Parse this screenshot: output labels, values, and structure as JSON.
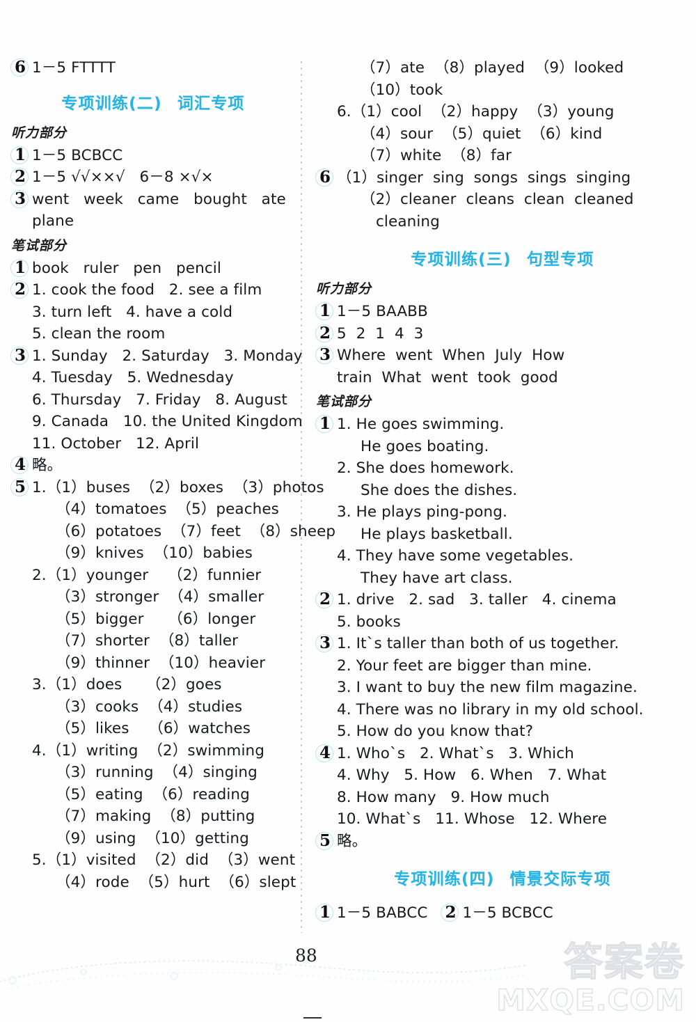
{
  "page": {
    "number": "88",
    "watermark_cn": "答案卷",
    "watermark_en": "MXQE.COM"
  },
  "labels": {
    "listening": "听力部分",
    "written": "笔试部分"
  },
  "sections": {
    "two": {
      "title": "专项训练(二)",
      "subtitle": "词汇专项"
    },
    "three": {
      "title": "专项训练(三)",
      "subtitle": "句型专项"
    },
    "four": {
      "title": "专项训练(四)",
      "subtitle": "情景交际专项"
    }
  },
  "left_column": {
    "carry_over": {
      "num": "6",
      "text": "1－5 FTTTT"
    },
    "listening": [
      {
        "num": "1",
        "lines": [
          "1－5 BCBCC"
        ]
      },
      {
        "num": "2",
        "lines": [
          "1－5 √√××√   6－8 ×√×"
        ]
      },
      {
        "num": "3",
        "lines": [
          "went   week   came   bought   ate",
          "plane"
        ]
      }
    ],
    "written": [
      {
        "num": "1",
        "lines": [
          "book   ruler   pen   pencil"
        ]
      },
      {
        "num": "2",
        "lines": [
          "1. cook the food   2. see a film",
          "3. turn left   4. have a cold",
          "5. clean the room"
        ]
      },
      {
        "num": "3",
        "lines": [
          "1. Sunday   2. Saturday   3. Monday",
          "4. Tuesday   5. Wednesday",
          "6. Thursday   7. Friday   8. August",
          "9. Canada   10. the United Kingdom",
          "11. October   12. April"
        ]
      },
      {
        "num": "4",
        "lines": [
          "略。"
        ]
      },
      {
        "num": "5",
        "lines": [
          "1.（1）buses  （2）boxes  （3）photos",
          "（4）tomatoes  （5）peaches",
          "（6）potatoes  （7）feet  （8）sheep",
          "（9）knives  （10）babies",
          "2.（1）younger    （2）funnier",
          "（3）stronger  （4）smaller",
          "（5）bigger     （6）longer",
          "（7）shorter  （8）taller",
          "（9）thinner  （10）heavier",
          "3.（1）does     （2）goes",
          "（3）cooks  （4）studies",
          "（5）likes    （6）watches",
          "4.（1）writing  （2）swimming",
          "（3）running  （4）singing",
          "（5）eating  （6）reading",
          "（7）making  （8）putting",
          "（9）using  （10）getting",
          "5.（1）visited  （2）did  （3）went",
          "（4）rode  （5）hurt  （6）slept"
        ]
      }
    ]
  },
  "right_column": {
    "continued_5": [
      "（7）ate  （8）played  （9）looked",
      "（10）took",
      "6.（1）cool  （2）happy  （3）young",
      "（4）sour  （5）quiet  （6）kind",
      "（7）white  （8）far"
    ],
    "q6": {
      "num": "6",
      "lines": [
        "（1）singer  sing  songs  sings  singing",
        "（2）cleaner  cleans  clean  cleaned",
        "cleaning"
      ]
    },
    "section3_listening": [
      {
        "num": "1",
        "lines": [
          "1－5 BAABB"
        ]
      },
      {
        "num": "2",
        "lines": [
          "5  2  1  4  3"
        ]
      },
      {
        "num": "3",
        "lines": [
          "Where  went  When  July  How",
          "train  What  went  took  good"
        ]
      }
    ],
    "section3_written": [
      {
        "num": "1",
        "lines": [
          "1. He goes swimming.",
          "He goes boating.",
          "2. She does homework.",
          "She does the dishes.",
          "3. He plays ping-pong.",
          "He plays basketball.",
          "4. They have some vegetables.",
          "They have art class."
        ]
      },
      {
        "num": "2",
        "lines": [
          "1. drive   2. sad   3. taller   4. cinema",
          "5. books"
        ]
      },
      {
        "num": "3",
        "lines": [
          "1. It`s taller than both of us together.",
          "2. Your feet are bigger than mine.",
          "3. I want to buy the new film magazine.",
          "4. There was no library in my old school.",
          "5. How do you know that?"
        ]
      },
      {
        "num": "4",
        "lines": [
          "1. Who`s   2. What`s   3. Which",
          "4. Why   5. How   6. When   7. What",
          "8. How many   9. How much",
          "10. What`s   11. Whose   12. Where"
        ]
      },
      {
        "num": "5",
        "lines": [
          "略。"
        ]
      }
    ],
    "section4": [
      {
        "num": "1",
        "text": "1－5 BABCC"
      },
      {
        "num": "2",
        "text": "1－5 BCBCC"
      }
    ]
  }
}
